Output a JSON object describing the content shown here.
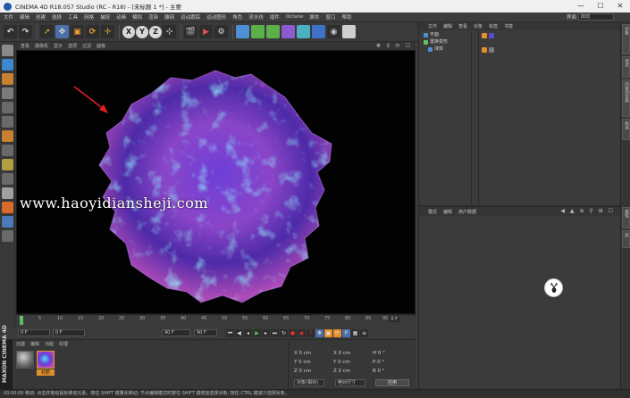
{
  "titlebar": {
    "title": "CINEMA 4D R18.057 Studio (RC - R18) - [未标题 1 *] - 主要",
    "minimize": "—",
    "maximize": "☐",
    "close": "✕"
  },
  "menubar": {
    "items": [
      "文件",
      "编辑",
      "创建",
      "选择",
      "工具",
      "网格",
      "捕捉",
      "动画",
      "模拟",
      "渲染",
      "雕刻",
      "运动跟踪",
      "运动图形",
      "角色",
      "流水线",
      "插件",
      "Octane",
      "脚本",
      "窗口",
      "帮助"
    ],
    "layout_label": "界面",
    "layout_value": "启动"
  },
  "toolbar": {
    "axis_x": "X",
    "axis_y": "Y",
    "axis_z": "Z"
  },
  "viewport": {
    "menu": [
      "查看",
      "摄像机",
      "显示",
      "选项",
      "过滤",
      "面板"
    ],
    "nav_icons": "✥ ⇕ ⟳ ☐"
  },
  "watermark": "www.haoyidiansheji.com",
  "timeline": {
    "ticks": [
      "0",
      "5",
      "10",
      "15",
      "20",
      "25",
      "30",
      "35",
      "40",
      "45",
      "50",
      "55",
      "60",
      "65",
      "70",
      "75",
      "80",
      "85",
      "90"
    ],
    "end_label": "0 F"
  },
  "transport": {
    "current": "0 F",
    "start": "0 F",
    "end": "90 F",
    "end2": "90 F"
  },
  "material_manager": {
    "menu": [
      "创建",
      "编辑",
      "功能",
      "纹理"
    ],
    "materials": [
      {
        "label": "",
        "color": "#8a8a8a"
      },
      {
        "label": "材质",
        "color": "#5a4ad0"
      }
    ],
    "brand": "MAXON CINEMA 4D"
  },
  "coordinates": {
    "rows": [
      {
        "a": "X  0 cm",
        "b": "X  0 cm",
        "c": "H  0 °"
      },
      {
        "a": "Y  0 cm",
        "b": "Y  0 cm",
        "c": "P  0 °"
      },
      {
        "a": "Z  0 cm",
        "b": "Z  0 cm",
        "c": "B  0 °"
      }
    ],
    "mode1": "对象(相对)",
    "mode2": "绝对尺寸",
    "apply": "应用"
  },
  "statusbar": "00:00:00    移动: 点击并拖动鼠标移动元素。按住 SHIFT 键量化移动; 节点编辑模式时按住 SHIFT 键增加选择对象; 按住 CTRL 键减少选择对象。",
  "object_manager": {
    "menu": [
      "文件",
      "编辑",
      "查看",
      "对象",
      "标签",
      "书签"
    ],
    "items": [
      {
        "name": "平面",
        "icon_color": "#4e8fd6"
      },
      {
        "name": "置换变形",
        "icon_color": "#6ac06a"
      },
      {
        "name": "球体",
        "icon_color": "#4e8fd6"
      }
    ]
  },
  "attribute_manager": {
    "menu": [
      "模式",
      "编辑",
      "用户数据"
    ],
    "nav_icons": "◀ ▲ ⊕ ⚲ ⊞ ☐"
  },
  "side_tabs": [
    "对象",
    "场次",
    "内容浏览器",
    "构造",
    "属性",
    "层"
  ],
  "colors": {
    "accent": "#5bc25b",
    "crystal_violet": "#7a3fd0",
    "crystal_cyan": "#3fd6e6",
    "crystal_pink": "#e64fb0",
    "arrow": "#e02020"
  }
}
